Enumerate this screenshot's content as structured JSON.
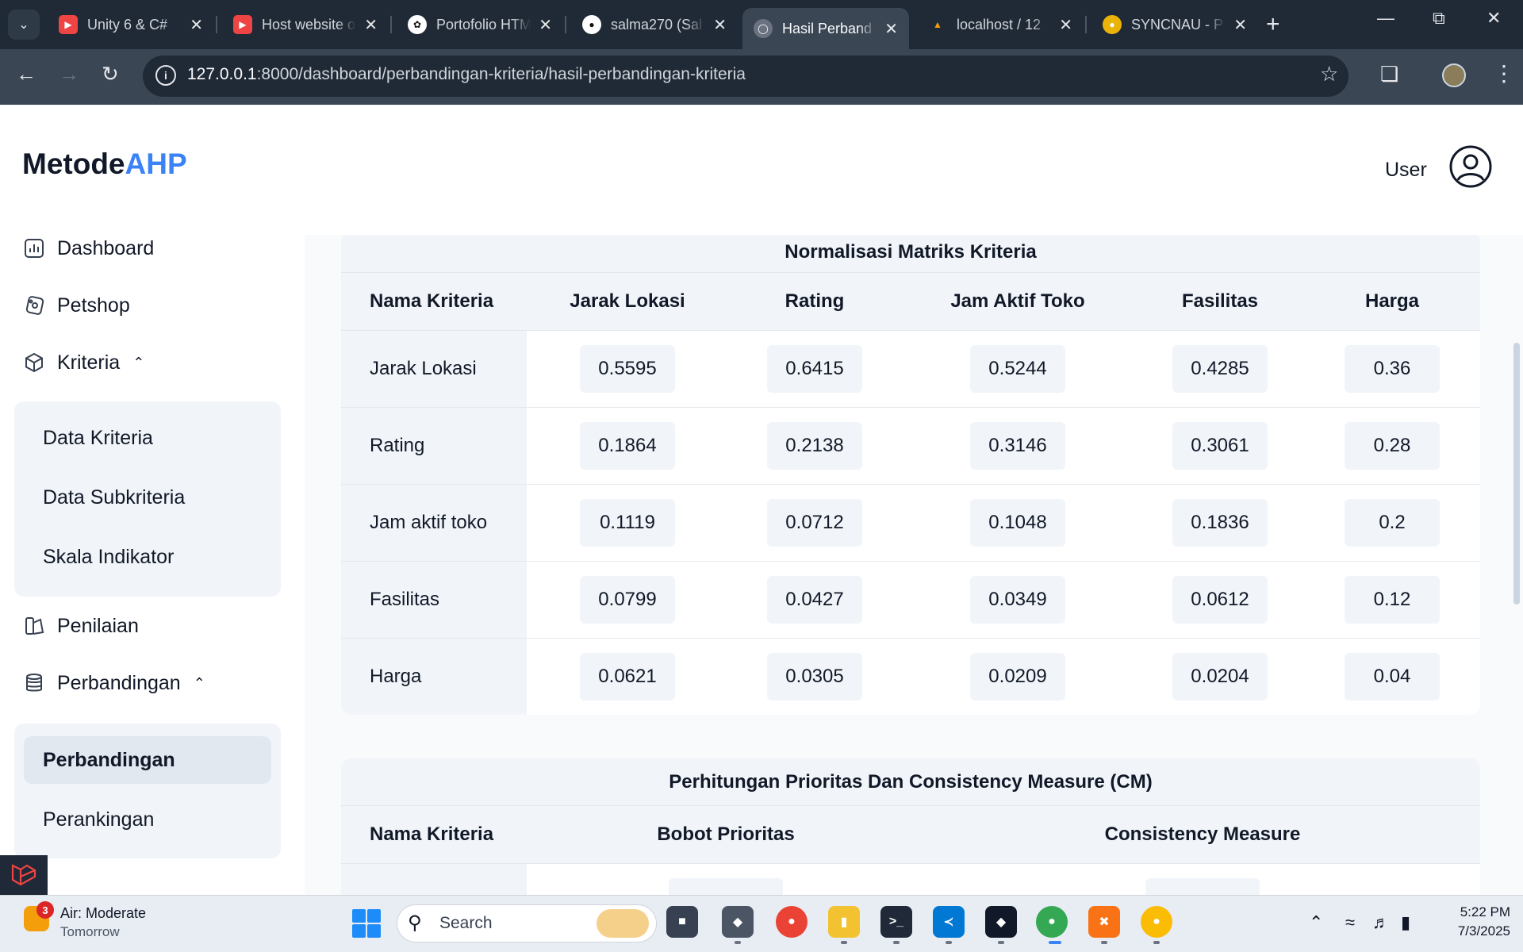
{
  "browser": {
    "tabs": [
      {
        "title": "Unity 6 & C#",
        "icon": "youtube-icon"
      },
      {
        "title": "Host website o",
        "icon": "youtube-icon"
      },
      {
        "title": "Portofolio HTM",
        "icon": "openai-icon"
      },
      {
        "title": "salma270 (Sal",
        "icon": "github-icon"
      },
      {
        "title": "Hasil Perband",
        "icon": "globe-icon"
      },
      {
        "title": "localhost / 12",
        "icon": "phpmyadmin-icon"
      },
      {
        "title": "SYNCNAU - P",
        "icon": "syncnau-icon"
      }
    ],
    "active_tab_index": 4,
    "url_host": "127.0.0.1",
    "url_path": ":8000/dashboard/perbandingan-kriteria/hasil-perbandingan-kriteria"
  },
  "sidebar": {
    "brand_main": "Metode",
    "brand_accent": "AHP",
    "items": [
      {
        "label": "Dashboard",
        "icon": "chart-icon"
      },
      {
        "label": "Petshop",
        "icon": "petshop-icon"
      },
      {
        "label": "Kriteria",
        "icon": "cube-icon"
      },
      {
        "label": "Penilaian",
        "icon": "document-icon"
      },
      {
        "label": "Perbandingan",
        "icon": "database-icon"
      }
    ],
    "kriteria_sub": [
      "Data Kriteria",
      "Data Subkriteria",
      "Skala Indikator"
    ],
    "perbandingan_sub": [
      "Perbandingan",
      "Perankingan"
    ]
  },
  "header": {
    "user_label": "User"
  },
  "normalisasi": {
    "title": "Normalisasi Matriks Kriteria",
    "headers": [
      "Nama Kriteria",
      "Jarak Lokasi",
      "Rating",
      "Jam Aktif Toko",
      "Fasilitas",
      "Harga"
    ],
    "rows": [
      {
        "name": "Jarak Lokasi",
        "values": [
          "0.5595",
          "0.6415",
          "0.5244",
          "0.4285",
          "0.36"
        ]
      },
      {
        "name": "Rating",
        "values": [
          "0.1864",
          "0.2138",
          "0.3146",
          "0.3061",
          "0.28"
        ]
      },
      {
        "name": "Jam aktif toko",
        "values": [
          "0.1119",
          "0.0712",
          "0.1048",
          "0.1836",
          "0.2"
        ]
      },
      {
        "name": "Fasilitas",
        "values": [
          "0.0799",
          "0.0427",
          "0.0349",
          "0.0612",
          "0.12"
        ]
      },
      {
        "name": "Harga",
        "values": [
          "0.0621",
          "0.0305",
          "0.0209",
          "0.0204",
          "0.04"
        ]
      }
    ]
  },
  "prioritas": {
    "title": "Perhitungan Prioritas Dan Consistency Measure (CM)",
    "headers": [
      "Nama Kriteria",
      "Bobot Prioritas",
      "Consistency Measure"
    ]
  },
  "taskbar": {
    "weather_title": "Air: Moderate",
    "weather_sub": "Tomorrow",
    "weather_badge": "3",
    "search_label": "Search",
    "time": "5:22 PM",
    "date": "7/3/2025"
  },
  "colors": {
    "accent": "#3b82f6",
    "chrome_dark": "#202a36",
    "card_header": "#f1f5f9"
  }
}
